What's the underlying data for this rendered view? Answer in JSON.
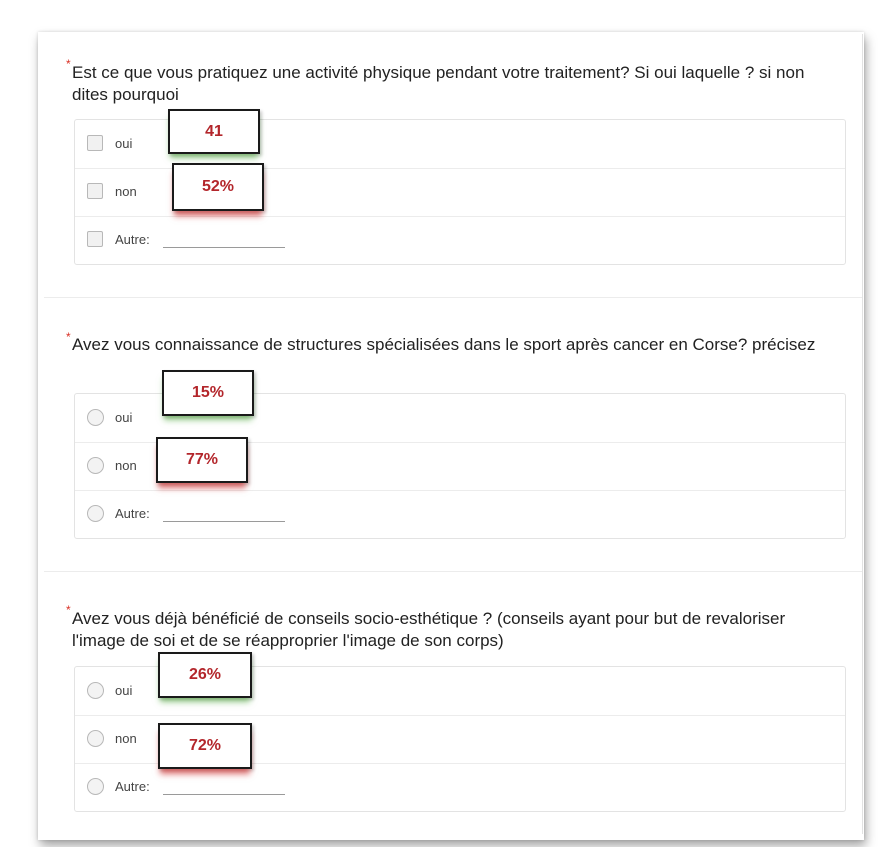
{
  "questions": [
    {
      "required_mark": "*",
      "text": "Est ce que vous pratiquez une activité physique pendant votre traitement? Si oui laquelle ? si non dites pourquoi",
      "input_type": "checkbox",
      "options": [
        {
          "label": "oui",
          "stat": "41"
        },
        {
          "label": "non",
          "stat": "52%"
        },
        {
          "label": "Autre:"
        }
      ]
    },
    {
      "required_mark": "*",
      "text": "Avez vous connaissance de structures spécialisées dans le sport après cancer en Corse? précisez",
      "input_type": "radio",
      "options": [
        {
          "label": "oui",
          "stat": "15%"
        },
        {
          "label": "non",
          "stat": "77%"
        },
        {
          "label": "Autre:"
        }
      ]
    },
    {
      "required_mark": "*",
      "text": "Avez vous déjà bénéficié de conseils socio-esthétique ? (conseils ayant pour but de revaloriser l'image de soi et de se réapproprier l'image de son corps)",
      "input_type": "radio",
      "options": [
        {
          "label": "oui",
          "stat": "26%"
        },
        {
          "label": "non",
          "stat": "72%"
        },
        {
          "label": "Autre:"
        }
      ]
    }
  ],
  "colors": {
    "required": "#d93025",
    "stat_text": "#b3262b",
    "stat_shadow_oui": "#3ca028",
    "stat_shadow_non": "#c81414"
  }
}
